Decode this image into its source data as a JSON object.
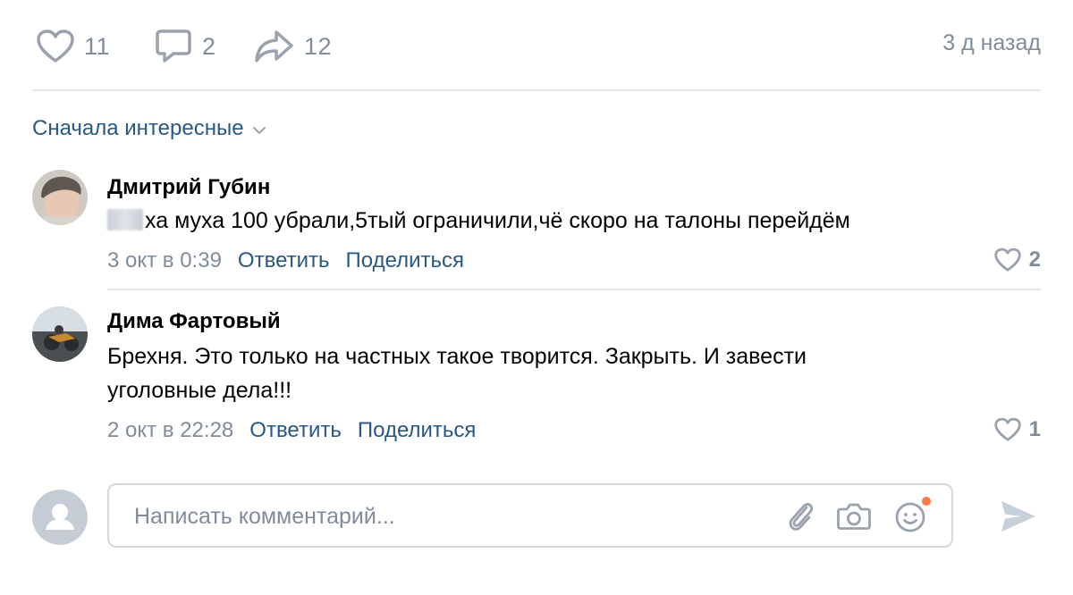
{
  "post": {
    "likes": "11",
    "comments": "2",
    "shares": "12",
    "time": "3 д назад"
  },
  "sort": {
    "label": "Сначала интересные"
  },
  "comments": [
    {
      "author": "Дмитрий Губин",
      "text": "ха муха 100 убрали,5тый ограничили,чё скоро на талоны перейдём",
      "date": "3 окт в 0:39",
      "reply": "Ответить",
      "share": "Поделиться",
      "likes": "2"
    },
    {
      "author": "Дима Фартовый",
      "text_line1": "Брехня. Это только на частных такое творится. Закрыть. И завести",
      "text_line2": "уголовные дела!!!",
      "date": "2 окт в 22:28",
      "reply": "Ответить",
      "share": "Поделиться",
      "likes": "1"
    }
  ],
  "composer": {
    "placeholder": "Написать комментарий..."
  },
  "colors": {
    "link": "#2a5885",
    "muted": "#818c99",
    "icon": "#99a2ad",
    "divider": "#e7e8ec",
    "badge": "#ff7a4d",
    "send": "#c5d0db"
  },
  "icons": [
    "heart-icon",
    "comment-icon",
    "share-icon",
    "chevron-down-icon",
    "user-icon",
    "paperclip-icon",
    "camera-icon",
    "smile-icon",
    "send-icon"
  ]
}
